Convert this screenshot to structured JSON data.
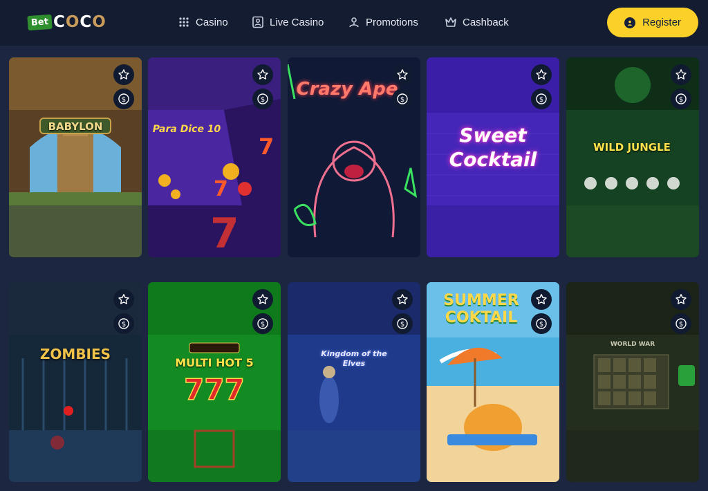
{
  "brand": {
    "prefix": "Bet",
    "name_left": "C",
    "name_o1": "O",
    "name_c": "C",
    "name_o2": "O"
  },
  "nav": [
    {
      "label": "Casino",
      "icon": "grid-icon"
    },
    {
      "label": "Live Casino",
      "icon": "id-card-icon"
    },
    {
      "label": "Promotions",
      "icon": "users-icon"
    },
    {
      "label": "Cashback",
      "icon": "crown-icon"
    }
  ],
  "register": {
    "label": "Register",
    "icon": "user-circle-icon"
  },
  "games": [
    {
      "title": "BABYLON",
      "colors": [
        "#8a6a3a",
        "#3f6b3c"
      ]
    },
    {
      "title": "Para Dice 10",
      "colors": [
        "#3a1e7a",
        "#5a2aa8"
      ]
    },
    {
      "title": "Crazy Ape",
      "colors": [
        "#101a3a",
        "#0f1b2e"
      ]
    },
    {
      "title": "Sweet Cocktail",
      "colors": [
        "#3b1a9e",
        "#6a2ad0"
      ]
    },
    {
      "title": "WILD JUNGLE",
      "colors": [
        "#0f3a1c",
        "#1a5a28"
      ]
    },
    {
      "title": "ZOMBIES",
      "colors": [
        "#1a2a3a",
        "#244a6a"
      ]
    },
    {
      "title": "MULTI HOT 5",
      "colors": [
        "#0f6a1a",
        "#1a9a2a"
      ]
    },
    {
      "title": "Kingdom of the Elves",
      "colors": [
        "#1a2a6a",
        "#2a4aa8"
      ]
    },
    {
      "title": "SUMMER COKTAIL",
      "colors": [
        "#4ab0e0",
        "#f5d08a"
      ]
    },
    {
      "title": "WORLD WAR",
      "colors": [
        "#1f2a1a",
        "#2f3a22"
      ]
    }
  ],
  "colors": {
    "header_bg": "#141c31",
    "page_bg": "#1c2640",
    "accent": "#fbd129"
  }
}
